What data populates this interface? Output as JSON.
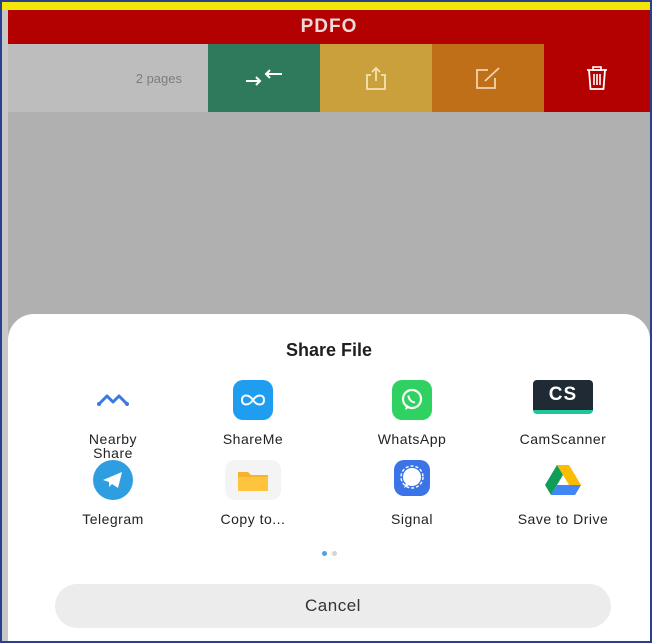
{
  "app": {
    "title": "PDFO"
  },
  "toolbar": {
    "pages_label": "2 pages",
    "actions": [
      {
        "name": "merge",
        "icon": "merge-arrows-icon",
        "color": "#2f7a5c"
      },
      {
        "name": "share",
        "icon": "share-upload-icon",
        "color": "#c9a03b"
      },
      {
        "name": "edit",
        "icon": "edit-pencil-icon",
        "color": "#bf6f17"
      },
      {
        "name": "delete",
        "icon": "trash-icon",
        "color": "#b30000"
      }
    ]
  },
  "share_sheet": {
    "title": "Share File",
    "apps": [
      {
        "label": "Nearby Share",
        "icon": "nearby-share-icon"
      },
      {
        "label": "ShareMe",
        "icon": "shareme-icon"
      },
      {
        "label": "WhatsApp",
        "icon": "whatsapp-icon"
      },
      {
        "label": "CamScanner",
        "icon": "camscanner-icon",
        "icon_text": "CS"
      },
      {
        "label": "Telegram",
        "icon": "telegram-icon"
      },
      {
        "label": "Copy to...",
        "icon": "folder-icon"
      },
      {
        "label": "Signal",
        "icon": "signal-icon"
      },
      {
        "label": "Save to Drive",
        "icon": "google-drive-icon"
      }
    ],
    "page_indicator": {
      "current": 1,
      "total": 2
    },
    "cancel_label": "Cancel"
  },
  "colors": {
    "title_bar": "#b30000",
    "accent_dot": "#4aa3e8"
  }
}
